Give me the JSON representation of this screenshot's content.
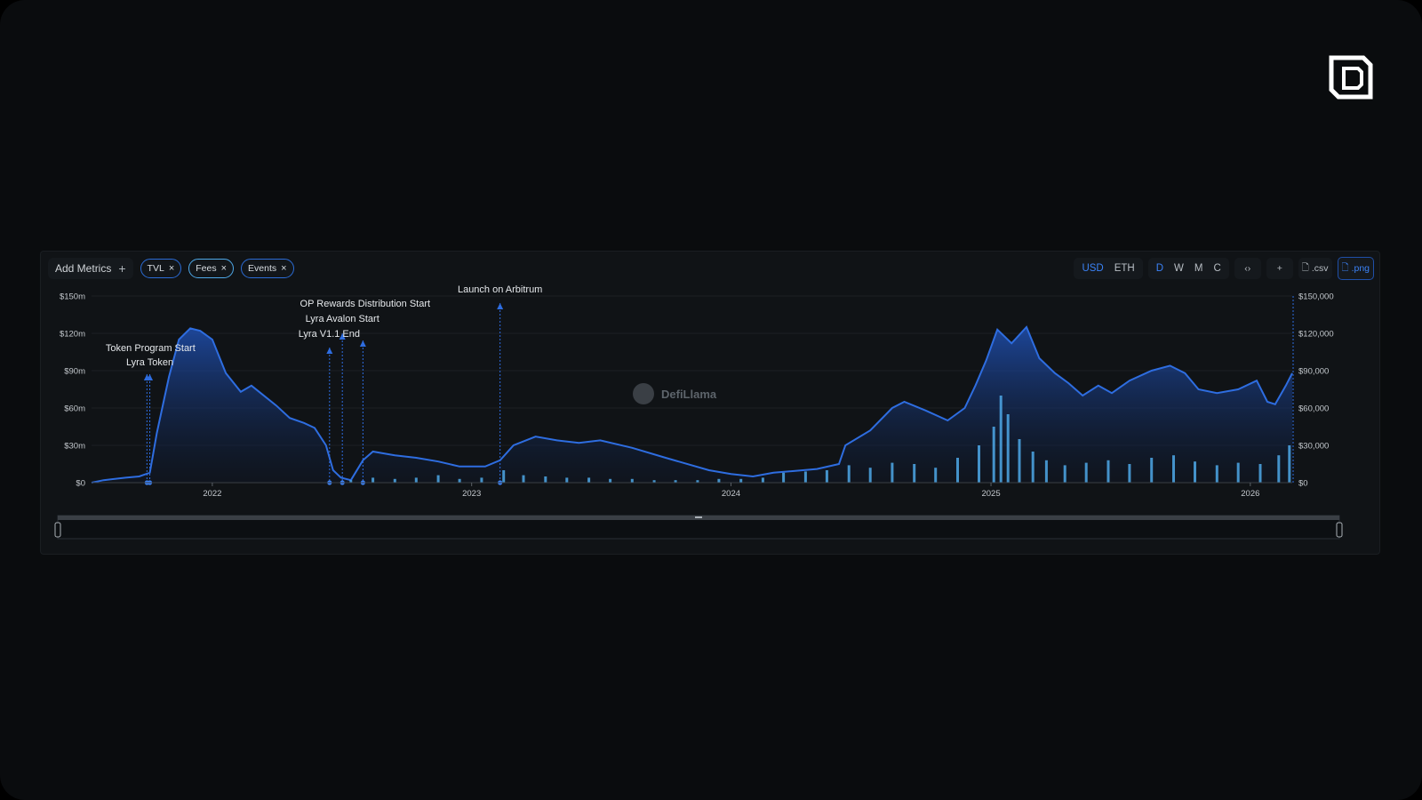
{
  "toolbar": {
    "add_metrics_label": "Add Metrics",
    "plus_glyph": "+",
    "pills": [
      {
        "label": "TVL",
        "close": "×",
        "color": "#2b6cd6"
      },
      {
        "label": "Fees",
        "close": "×",
        "color": "#4ea8e8"
      },
      {
        "label": "Events",
        "close": "×",
        "color": "#2b6cd6"
      }
    ],
    "denomination": [
      "USD",
      "ETH"
    ],
    "active_denomination": "USD",
    "periods": [
      "D",
      "W",
      "M",
      "C"
    ],
    "active_period": "D",
    "embed_glyph": "‹›",
    "add_glyph": "+",
    "csv_label": ".csv",
    "png_label": ".png",
    "doc_icon": "file-icon"
  },
  "watermark": "DefiLlama",
  "colors": {
    "tvl": "#2e6de0",
    "fees": "#4ea8e8",
    "background": "#101316",
    "accent": "#3b82f6"
  },
  "chart_data": {
    "type": "line",
    "x_type": "date",
    "xlim": [
      "2021-07-15",
      "2026-03-01"
    ],
    "x_ticks": [
      "2022",
      "2023",
      "2024",
      "2025",
      "2026"
    ],
    "x_tick_dates": [
      "2022-01-01",
      "2023-01-01",
      "2024-01-01",
      "2025-01-01",
      "2026-01-01"
    ],
    "left_axis": {
      "ticks": [
        "$0",
        "$30m",
        "$60m",
        "$90m",
        "$120m",
        "$150m"
      ],
      "ylim": [
        0,
        150000000
      ]
    },
    "right_axis": {
      "ticks": [
        "$0",
        "$30,000",
        "$60,000",
        "$90,000",
        "$120,000",
        "$150,000"
      ],
      "ylim": [
        0,
        150000
      ]
    },
    "series": [
      {
        "name": "TVL",
        "axis": "left",
        "kind": "area",
        "points": [
          [
            "2021-07-15",
            0
          ],
          [
            "2021-08-01",
            2000000
          ],
          [
            "2021-09-01",
            4000000
          ],
          [
            "2021-09-20",
            5000000
          ],
          [
            "2021-10-05",
            8000000
          ],
          [
            "2021-10-15",
            40000000
          ],
          [
            "2021-11-01",
            85000000
          ],
          [
            "2021-11-15",
            115000000
          ],
          [
            "2021-12-01",
            124000000
          ],
          [
            "2021-12-15",
            122000000
          ],
          [
            "2022-01-01",
            115000000
          ],
          [
            "2022-01-20",
            88000000
          ],
          [
            "2022-02-10",
            73000000
          ],
          [
            "2022-02-25",
            78000000
          ],
          [
            "2022-03-10",
            72000000
          ],
          [
            "2022-04-01",
            62000000
          ],
          [
            "2022-04-20",
            52000000
          ],
          [
            "2022-05-10",
            48000000
          ],
          [
            "2022-05-25",
            44000000
          ],
          [
            "2022-06-10",
            30000000
          ],
          [
            "2022-06-20",
            10000000
          ],
          [
            "2022-07-01",
            4000000
          ],
          [
            "2022-07-15",
            2000000
          ],
          [
            "2022-08-01",
            18000000
          ],
          [
            "2022-08-15",
            25000000
          ],
          [
            "2022-09-15",
            22000000
          ],
          [
            "2022-10-15",
            20000000
          ],
          [
            "2022-11-15",
            17000000
          ],
          [
            "2022-12-15",
            13000000
          ],
          [
            "2023-01-20",
            13000000
          ],
          [
            "2023-02-10",
            18000000
          ],
          [
            "2023-03-01",
            30000000
          ],
          [
            "2023-04-01",
            37000000
          ],
          [
            "2023-05-01",
            34000000
          ],
          [
            "2023-06-01",
            32000000
          ],
          [
            "2023-07-01",
            34000000
          ],
          [
            "2023-08-15",
            28000000
          ],
          [
            "2023-10-01",
            20000000
          ],
          [
            "2023-12-01",
            10000000
          ],
          [
            "2024-01-01",
            7000000
          ],
          [
            "2024-02-01",
            5000000
          ],
          [
            "2024-03-01",
            8000000
          ],
          [
            "2024-05-01",
            11000000
          ],
          [
            "2024-06-01",
            15000000
          ],
          [
            "2024-06-10",
            30000000
          ],
          [
            "2024-07-15",
            42000000
          ],
          [
            "2024-08-15",
            60000000
          ],
          [
            "2024-09-01",
            65000000
          ],
          [
            "2024-10-01",
            58000000
          ],
          [
            "2024-11-01",
            50000000
          ],
          [
            "2024-11-25",
            60000000
          ],
          [
            "2024-12-10",
            78000000
          ],
          [
            "2024-12-25",
            98000000
          ],
          [
            "2025-01-10",
            123000000
          ],
          [
            "2025-01-30",
            112000000
          ],
          [
            "2025-02-20",
            125000000
          ],
          [
            "2025-03-10",
            100000000
          ],
          [
            "2025-04-01",
            88000000
          ],
          [
            "2025-04-20",
            80000000
          ],
          [
            "2025-05-10",
            70000000
          ],
          [
            "2025-06-01",
            78000000
          ],
          [
            "2025-06-20",
            72000000
          ],
          [
            "2025-07-15",
            82000000
          ],
          [
            "2025-08-15",
            90000000
          ],
          [
            "2025-09-10",
            94000000
          ],
          [
            "2025-10-01",
            88000000
          ],
          [
            "2025-10-20",
            75000000
          ],
          [
            "2025-11-15",
            72000000
          ],
          [
            "2025-12-15",
            75000000
          ],
          [
            "2026-01-10",
            82000000
          ],
          [
            "2026-01-25",
            65000000
          ],
          [
            "2026-02-05",
            63000000
          ],
          [
            "2026-02-20",
            78000000
          ],
          [
            "2026-03-01",
            88000000
          ]
        ]
      },
      {
        "name": "Fees",
        "axis": "right",
        "kind": "bar",
        "points": [
          [
            "2022-07-15",
            2000
          ],
          [
            "2022-08-15",
            4000
          ],
          [
            "2022-09-15",
            3000
          ],
          [
            "2022-10-15",
            4000
          ],
          [
            "2022-11-15",
            6000
          ],
          [
            "2022-12-15",
            3000
          ],
          [
            "2023-01-15",
            4000
          ],
          [
            "2023-02-15",
            10000
          ],
          [
            "2023-03-15",
            6000
          ],
          [
            "2023-04-15",
            5000
          ],
          [
            "2023-05-15",
            4000
          ],
          [
            "2023-06-15",
            4000
          ],
          [
            "2023-07-15",
            3000
          ],
          [
            "2023-08-15",
            3000
          ],
          [
            "2023-09-15",
            2000
          ],
          [
            "2023-10-15",
            2000
          ],
          [
            "2023-11-15",
            2000
          ],
          [
            "2023-12-15",
            3000
          ],
          [
            "2024-01-15",
            3000
          ],
          [
            "2024-02-15",
            4000
          ],
          [
            "2024-03-15",
            8000
          ],
          [
            "2024-04-15",
            9000
          ],
          [
            "2024-05-15",
            10000
          ],
          [
            "2024-06-15",
            14000
          ],
          [
            "2024-07-15",
            12000
          ],
          [
            "2024-08-15",
            16000
          ],
          [
            "2024-09-15",
            15000
          ],
          [
            "2024-10-15",
            12000
          ],
          [
            "2024-11-15",
            20000
          ],
          [
            "2024-12-15",
            30000
          ],
          [
            "2025-01-05",
            45000
          ],
          [
            "2025-01-15",
            70000
          ],
          [
            "2025-01-25",
            55000
          ],
          [
            "2025-02-10",
            35000
          ],
          [
            "2025-03-01",
            25000
          ],
          [
            "2025-03-20",
            18000
          ],
          [
            "2025-04-15",
            14000
          ],
          [
            "2025-05-15",
            16000
          ],
          [
            "2025-06-15",
            18000
          ],
          [
            "2025-07-15",
            15000
          ],
          [
            "2025-08-15",
            20000
          ],
          [
            "2025-09-15",
            22000
          ],
          [
            "2025-10-15",
            17000
          ],
          [
            "2025-11-15",
            14000
          ],
          [
            "2025-12-15",
            16000
          ],
          [
            "2026-01-15",
            15000
          ],
          [
            "2026-02-10",
            22000
          ],
          [
            "2026-02-25",
            30000
          ]
        ]
      }
    ],
    "events": [
      {
        "label": "Token Program Start",
        "date": "2021-10-01"
      },
      {
        "label": "Lyra Token",
        "date": "2021-10-05"
      },
      {
        "label": "OP Rewards Distribution Start",
        "date": "2022-06-15"
      },
      {
        "label": "Lyra Avalon Start",
        "date": "2022-07-03"
      },
      {
        "label": "Lyra V1.1 End",
        "date": "2022-08-01"
      },
      {
        "label": "Launch on Arbitrum",
        "date": "2023-02-10"
      }
    ]
  }
}
